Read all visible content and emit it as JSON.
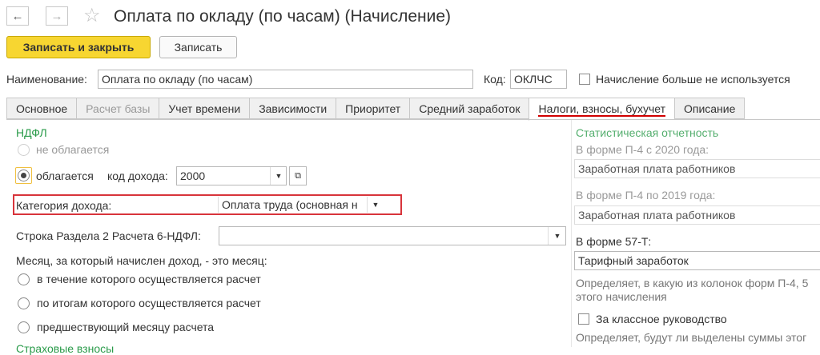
{
  "window": {
    "title": "Оплата по окладу (по часам) (Начисление)",
    "back_glyph": "←",
    "forward_glyph": "→",
    "star_glyph": "☆"
  },
  "toolbar": {
    "save_close_label": "Записать и закрыть",
    "save_label": "Записать"
  },
  "header": {
    "name_label": "Наименование:",
    "name_value": "Оплата по окладу (по часам)",
    "code_label": "Код:",
    "code_value": "ОКЛЧС",
    "unused_label": "Начисление больше не используется"
  },
  "tabs": [
    {
      "label": "Основное"
    },
    {
      "label": "Расчет базы"
    },
    {
      "label": "Учет времени"
    },
    {
      "label": "Зависимости"
    },
    {
      "label": "Приоритет"
    },
    {
      "label": "Средний заработок"
    },
    {
      "label": "Налоги, взносы, бухучет"
    },
    {
      "label": "Описание"
    }
  ],
  "ndfl": {
    "section_title": "НДФЛ",
    "not_taxed_label": "не облагается",
    "taxed_label": "облагается",
    "income_code_label": "код дохода:",
    "income_code_value": "2000",
    "income_category_label": "Категория дохода:",
    "income_category_value": "Оплата труда (основная н",
    "row_6ndfl_label": "Строка Раздела 2 Расчета 6-НДФЛ:",
    "row_6ndfl_value": "",
    "month_question": "Месяц, за который начислен доход, - это месяц:",
    "month_options": [
      "в течение которого осуществляется расчет",
      "по итогам которого осуществляется расчет",
      "предшествующий месяцу расчета"
    ],
    "cut_label": "Страховые взносы"
  },
  "stats": {
    "section_title": "Статистическая отчетность",
    "p4_2020_label": "В форме П-4 с 2020 года:",
    "p4_2020_value": "Заработная плата работников",
    "p4_2019_label": "В форме П-4 по 2019 года:",
    "p4_2019_value": "Заработная плата работников",
    "f57_label": "В форме 57-Т:",
    "f57_value": "Тарифный заработок",
    "hint1_line1": "Определяет, в какую из колонок форм П-4, 5",
    "hint1_line2": "этого начисления",
    "class_guidance_label": "За классное руководство",
    "hint2_line1": "Определяет, будут ли выделены суммы этог"
  }
}
